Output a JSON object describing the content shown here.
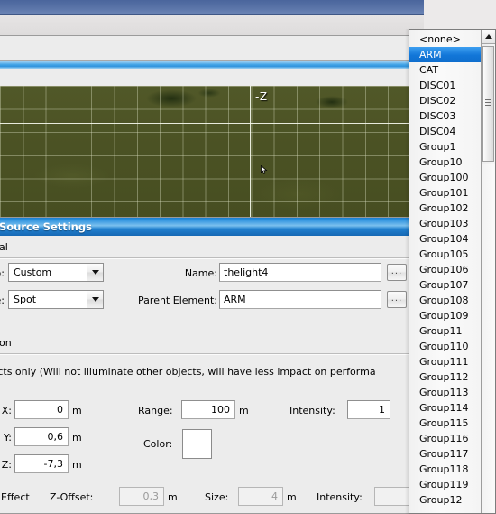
{
  "viewport": {
    "axis_label": "-Z"
  },
  "dialog": {
    "title": "Source Settings",
    "group_general": "al",
    "group_illumination": "on",
    "hint": "ffects only (Will not illuminate other objects, will have less impact on performa",
    "fields": {
      "type_label": "p:",
      "type_value": "Custom",
      "mode_label": "e:",
      "mode_value": "Spot",
      "name_label": "Name:",
      "name_value": "thelight4",
      "parent_label": "Parent Element:",
      "parent_value": "ARM",
      "browse_label": "...",
      "pos_x_label": "s X:",
      "pos_x_value": "0",
      "pos_y_label": "s Y:",
      "pos_y_value": "0,6",
      "pos_z_label": "s Z:",
      "pos_z_value": "-7,3",
      "range_label": "Range:",
      "range_value": "100",
      "intensity_label": "Intensity:",
      "intensity_value": "1",
      "color_label": "Color:",
      "color_value": "#ffffff",
      "halo_label": "alo Effect",
      "zoffset_label": "Z-Offset:",
      "zoffset_value": "0,3",
      "size_label": "Size:",
      "size_value": "4",
      "halo_intensity_label": "Intensity:",
      "halo_intensity_value": "",
      "unit_m": "m"
    }
  },
  "dropdown": {
    "selected": "ARM",
    "items": [
      "<none>",
      "ARM",
      "CAT",
      "DISC01",
      "DISC02",
      "DISC03",
      "DISC04",
      "Group1",
      "Group10",
      "Group100",
      "Group101",
      "Group102",
      "Group103",
      "Group104",
      "Group105",
      "Group106",
      "Group107",
      "Group108",
      "Group109",
      "Group11",
      "Group110",
      "Group111",
      "Group112",
      "Group113",
      "Group114",
      "Group115",
      "Group116",
      "Group117",
      "Group118",
      "Group119",
      "Group12"
    ]
  }
}
